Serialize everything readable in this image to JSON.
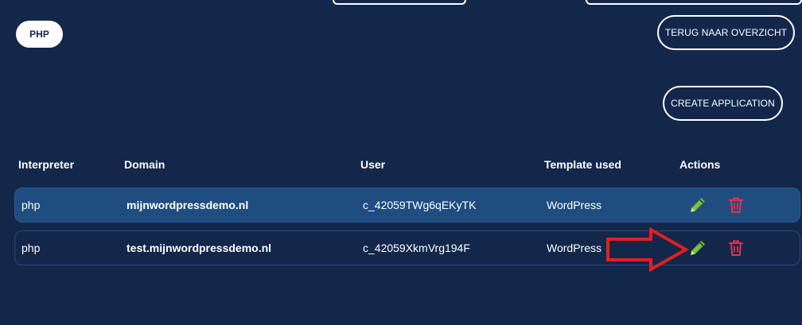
{
  "tabs": {
    "active_label": "PHP"
  },
  "buttons": {
    "back_label": "TERUG NAAR OVERZICHT",
    "create_label": "CREATE APPLICATION"
  },
  "table": {
    "headers": [
      "Interpreter",
      "Domain",
      "User",
      "Template used",
      "Actions"
    ],
    "rows": [
      {
        "interpreter": "php",
        "domain": "mijnwordpressdemo.nl",
        "user": "c_42059TWg6qEKyTK",
        "template": "WordPress"
      },
      {
        "interpreter": "php",
        "domain": "test.mijnwordpressdemo.nl",
        "user": "c_42059XkmVrg194F",
        "template": "WordPress"
      }
    ]
  },
  "icons": {
    "edit": "pencil-icon",
    "delete": "trash-icon"
  },
  "colors": {
    "background": "#13274b",
    "highlight_row": "#1f4d80",
    "edit_icon": "#7fc241",
    "delete_icon": "#e0334c",
    "annotation_arrow": "#e02020"
  }
}
